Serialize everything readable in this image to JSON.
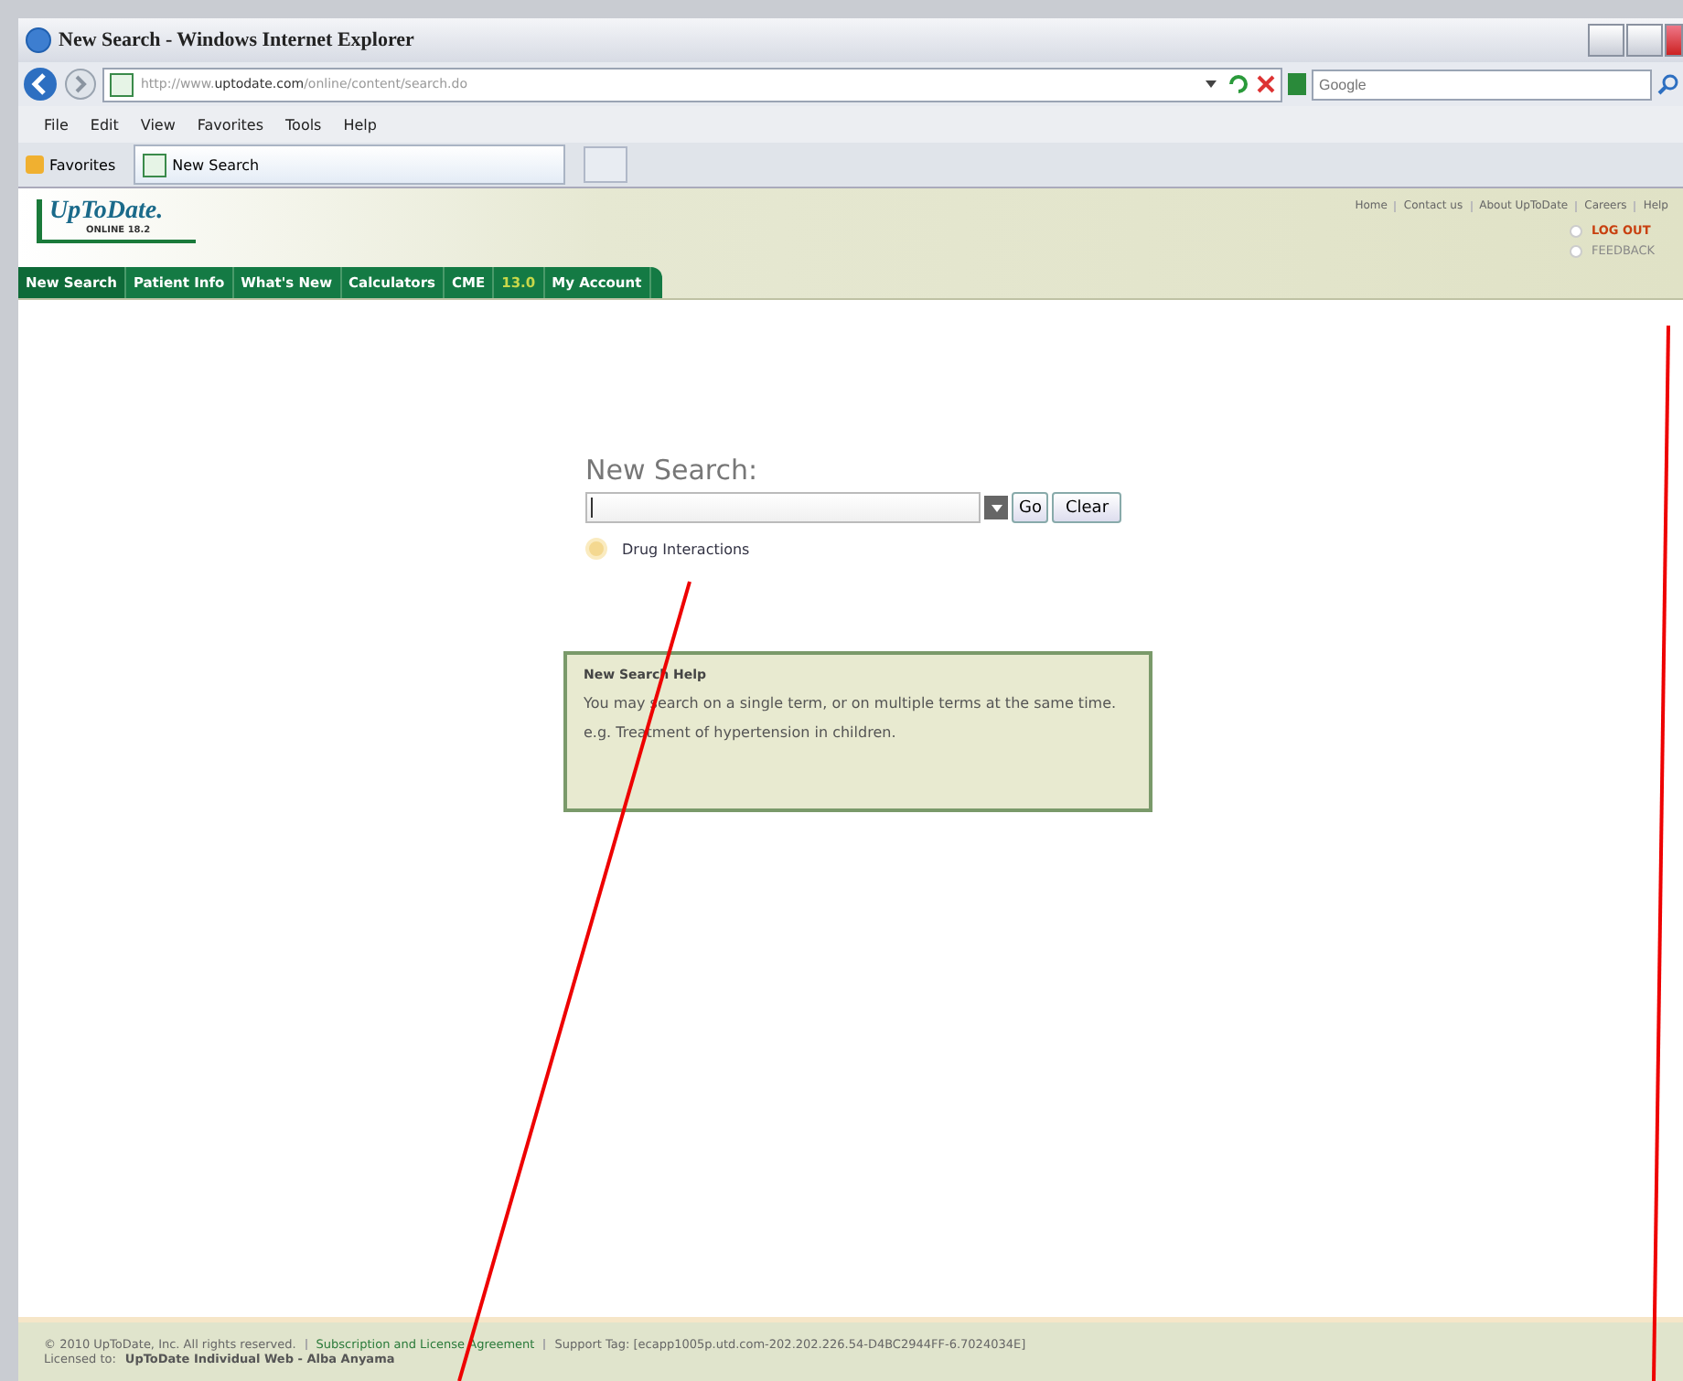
{
  "window": {
    "title": "New Search - Windows Internet Explorer"
  },
  "address_bar": {
    "url_prefix": "http://www.",
    "url_domain": "uptodate.com",
    "url_path": "/online/content/search.do",
    "search_placeholder": "Google"
  },
  "menu": [
    "File",
    "Edit",
    "View",
    "Favorites",
    "Tools",
    "Help"
  ],
  "favorites_bar": {
    "favorites": "Favorites",
    "tab": "New Search"
  },
  "site_header": {
    "logo": "UpToDate.",
    "edition": "ONLINE 18.2",
    "top_links": [
      "Home",
      "Contact us",
      "About UpToDate",
      "Careers",
      "Help"
    ],
    "account_links": [
      {
        "label": "LOG OUT",
        "kind": "alert"
      },
      {
        "label": "FEEDBACK",
        "kind": "plain"
      }
    ],
    "nav": [
      {
        "label": "New Search",
        "selected": true,
        "kind": "tab"
      },
      {
        "label": "Patient Info",
        "selected": false,
        "kind": "tab"
      },
      {
        "label": "What's New",
        "selected": false,
        "kind": "tab"
      },
      {
        "label": "Calculators",
        "selected": false,
        "kind": "tab"
      },
      {
        "label": "CME",
        "selected": false,
        "kind": "tab"
      },
      {
        "label": "13.0",
        "selected": false,
        "kind": "credit"
      },
      {
        "label": "My Account",
        "selected": false,
        "kind": "tab"
      }
    ]
  },
  "search": {
    "heading": "New Search:",
    "go": "Go",
    "clear": "Clear",
    "drug_link": "Drug Interactions"
  },
  "help_box": {
    "title": "New Search Help",
    "paragraphs": [
      "You may search on a single term, or on multiple terms at the same time.",
      "e.g. Treatment of hypertension in children."
    ]
  },
  "footer": {
    "copyright": "© 2010 UpToDate, Inc. All rights reserved.",
    "agreement": "Subscription and License Agreement",
    "support": "Support Tag: [ecapp1005p.utd.com-202.202.226.54-D4BC2944FF-6.7024034E]",
    "licensed_label": "Licensed to:",
    "licensee": "UpToDate Individual Web - Alba Anyama"
  }
}
